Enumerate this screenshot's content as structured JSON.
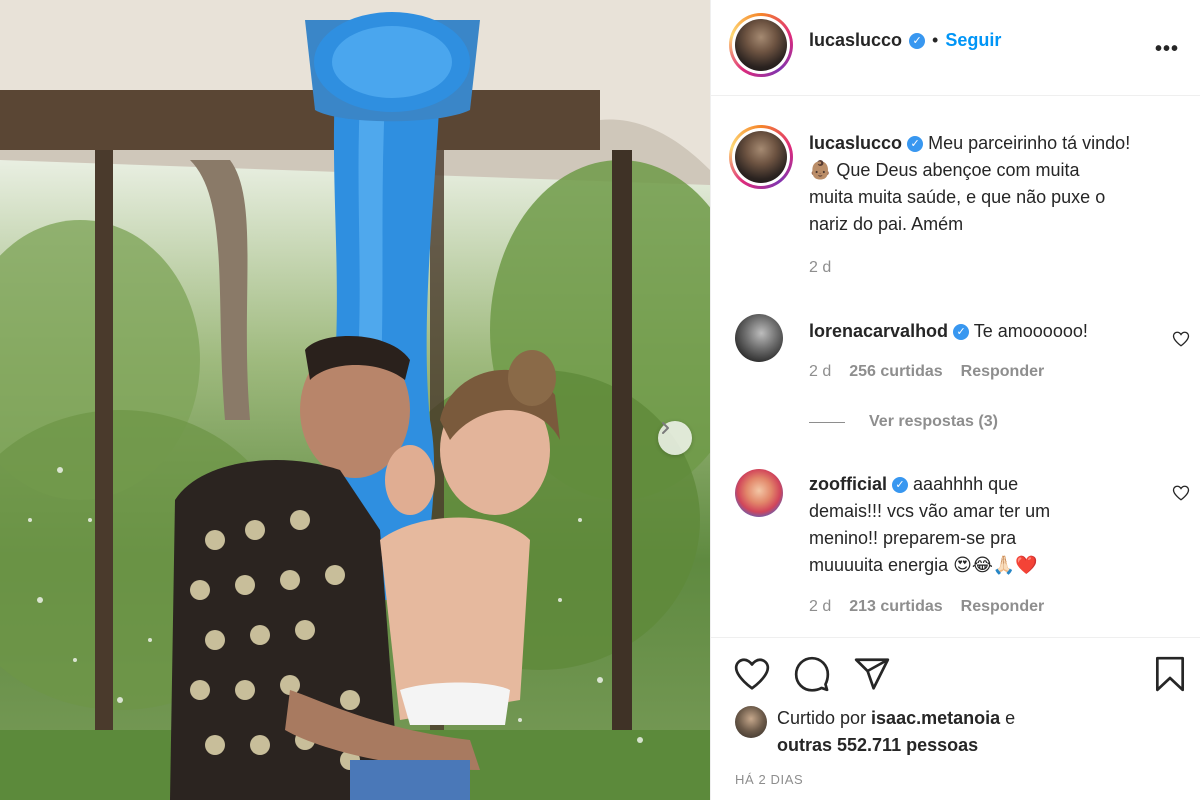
{
  "post": {
    "author": "lucaslucco",
    "follow_label": "Seguir",
    "separator": "•",
    "more_label": "•••"
  },
  "caption": {
    "username": "lucaslucco",
    "text_line1": "Meu parceirinho tá vindo!",
    "emoji": "👶🏽",
    "text_line2": " Que Deus abençoe com muita",
    "text_line3": "muita muita saúde, e que não puxe o",
    "text_line4": "nariz do pai. Amém",
    "time": "2 d"
  },
  "comments": [
    {
      "username": "lorenacarvalhod",
      "text": "Te amoooooo!",
      "time": "2 d",
      "likes": "256 curtidas",
      "reply_label": "Responder",
      "view_replies": "Ver respostas (3)"
    },
    {
      "username": "zoofficial",
      "text_line1": "aaahhhh que",
      "text_line2": "demais!!! vcs vão amar ter um",
      "text_line3": "menino!! preparem-se pra",
      "text_line4": "muuuuita energia 😍😂🙏🏻❤️",
      "time": "2 d",
      "likes": "213 curtidas",
      "reply_label": "Responder"
    }
  ],
  "likes": {
    "prefix": "Curtido por ",
    "user": "isaac.metanoia",
    "connector": " e",
    "others": "outras 552.711 pessoas"
  },
  "date_label": "HÁ 2 DIAS",
  "icons": {
    "verified": "verified-badge-icon",
    "heart": "heart-icon",
    "comment": "comment-icon",
    "share": "share-icon",
    "save": "bookmark-icon",
    "next": "chevron-right-icon"
  },
  "colors": {
    "accent": "#0095f6",
    "verified": "#3897f0",
    "muted": "#8e8e8e",
    "text": "#262626",
    "paint": "#2f8fe0"
  }
}
